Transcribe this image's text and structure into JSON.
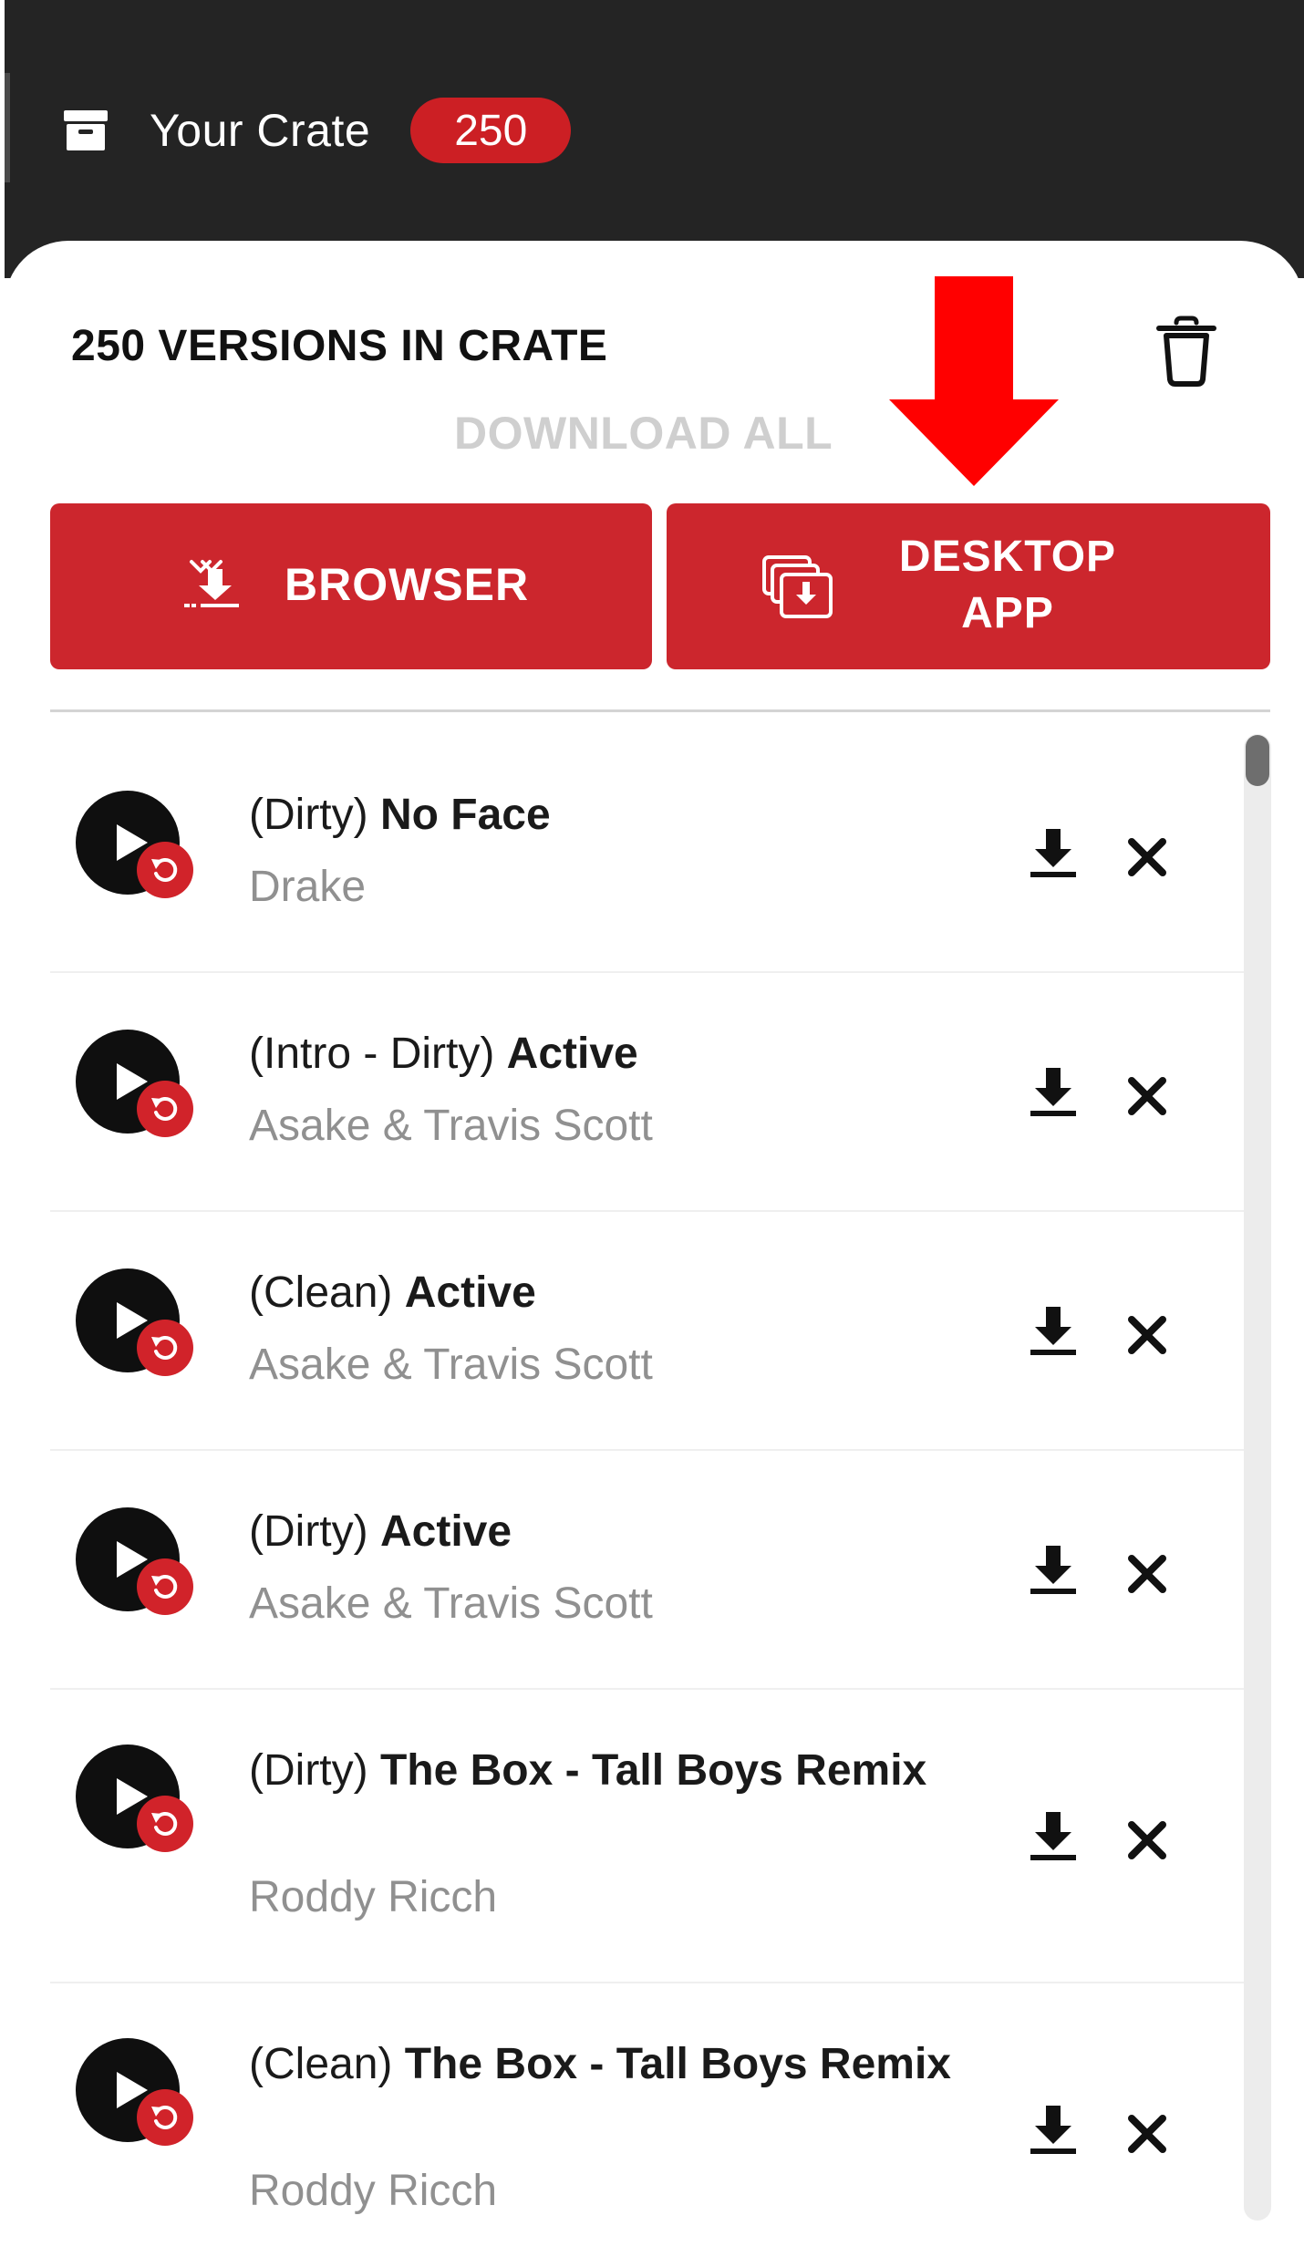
{
  "header": {
    "crate_label": "Your Crate",
    "crate_count": "250",
    "crate_icon": "archive-box-icon"
  },
  "panel": {
    "title": "250 VERSIONS IN CRATE",
    "download_all_label": "DOWNLOAD ALL",
    "trash_icon": "trash-icon",
    "browser_label": "BROWSER",
    "desktop_label_line1": "DESKTOP",
    "desktop_label_line2": "APP"
  },
  "colors": {
    "accent_red": "#cc262d",
    "header_bg": "#242424",
    "annotation_red": "#ff0000"
  },
  "tracks": [
    {
      "version": "(Dirty)",
      "title": "No Face",
      "artist": "Drake"
    },
    {
      "version": "(Intro - Dirty)",
      "title": "Active",
      "artist": "Asake & Travis Scott"
    },
    {
      "version": "(Clean)",
      "title": "Active",
      "artist": "Asake & Travis Scott"
    },
    {
      "version": "(Dirty)",
      "title": "Active",
      "artist": "Asake & Travis Scott"
    },
    {
      "version": "(Dirty)",
      "title": "The Box - Tall Boys Remix",
      "artist": "Roddy Ricch"
    },
    {
      "version": "(Clean)",
      "title": "The Box - Tall Boys Remix",
      "artist": "Roddy Ricch"
    }
  ]
}
